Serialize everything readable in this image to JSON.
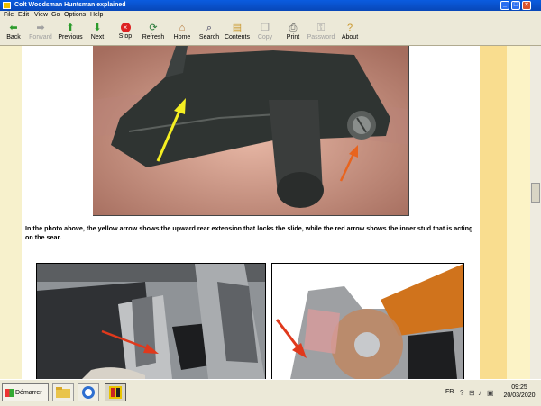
{
  "window": {
    "title": "Colt Woodsman Huntsman explained"
  },
  "menu": [
    "File",
    "Edit",
    "View",
    "Go",
    "Options",
    "Help"
  ],
  "toolbar": [
    {
      "label": "Back",
      "icon": "back-arrow-icon",
      "enabled": true
    },
    {
      "label": "Forward",
      "icon": "forward-arrow-icon",
      "enabled": false
    },
    {
      "label": "Previous",
      "icon": "up-arrow-icon",
      "enabled": true
    },
    {
      "label": "Next",
      "icon": "down-arrow-icon",
      "enabled": true
    },
    {
      "label": "Stop",
      "icon": "stop-icon",
      "enabled": true
    },
    {
      "label": "Refresh",
      "icon": "refresh-icon",
      "enabled": true
    },
    {
      "label": "Home",
      "icon": "home-icon",
      "enabled": true
    },
    {
      "label": "Search",
      "icon": "search-icon",
      "enabled": true
    },
    {
      "label": "Contents",
      "icon": "contents-icon",
      "enabled": true
    },
    {
      "label": "Copy",
      "icon": "copy-icon",
      "enabled": false
    },
    {
      "label": "Print",
      "icon": "print-icon",
      "enabled": true
    },
    {
      "label": "Password",
      "icon": "password-icon",
      "enabled": false
    },
    {
      "label": "About",
      "icon": "about-icon",
      "enabled": true
    }
  ],
  "content": {
    "caption": "In the photo above, the yellow arrow shows the upward rear extension that locks the slide, while the red arrow shows the inner stud that is acting on the sear."
  },
  "taskbar": {
    "start_label": "Démarrer",
    "language": "FR",
    "time": "09:25",
    "date": "20/03/2020"
  },
  "colors": {
    "arrow_yellow": "#f4ee22",
    "arrow_red": "#e0391c",
    "arrow_orange": "#e8641e"
  }
}
